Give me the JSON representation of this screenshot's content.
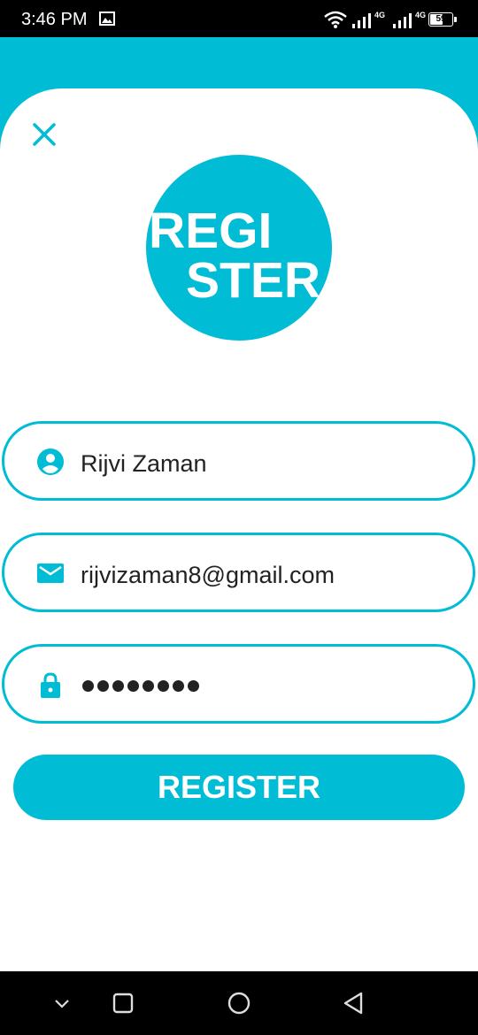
{
  "status_bar": {
    "time": "3:46 PM",
    "network_1": "4G",
    "network_2": "4G",
    "battery_level": "59",
    "battery_fraction": 0.59
  },
  "header": {
    "close_icon": "close-icon"
  },
  "logo": {
    "line_1": "REGI",
    "line_2": "STER"
  },
  "form": {
    "name": {
      "icon": "account-circle-icon",
      "value": "Rijvi Zaman"
    },
    "email": {
      "icon": "email-icon",
      "value": "rijvizaman8@gmail.com"
    },
    "password": {
      "icon": "lock-icon",
      "masked_length": 8
    },
    "submit_label": "REGISTER"
  },
  "nav_bar": {
    "items": [
      "chevron-down-icon",
      "recents-icon",
      "home-icon",
      "back-icon"
    ]
  },
  "colors": {
    "accent": "#00BCD4",
    "background": "#FFFFFF",
    "system_bar": "#000000"
  }
}
